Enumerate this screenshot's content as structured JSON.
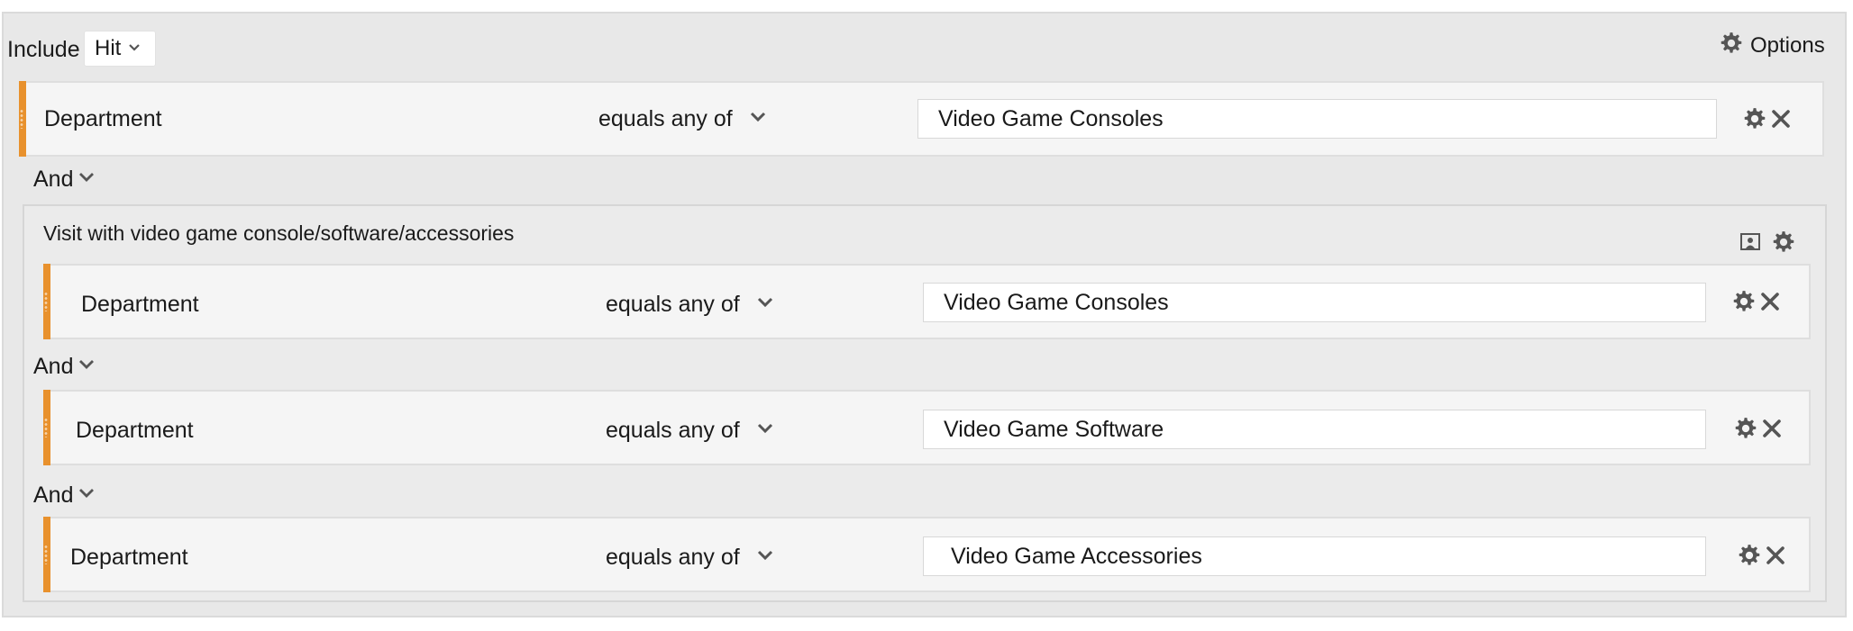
{
  "header": {
    "include_label": "Include",
    "include_value": "Hit",
    "options_label": "Options"
  },
  "top_rule": {
    "field": "Department",
    "operator": "equals any of",
    "value": "Video Game Consoles"
  },
  "top_conjunction": "And",
  "container": {
    "title": "Visit with video game console/software/accessories",
    "rules": [
      {
        "field": "Department",
        "operator": "equals any of",
        "value": "Video Game Consoles"
      },
      {
        "field": "Department",
        "operator": "equals any of",
        "value": "Video Game Software"
      },
      {
        "field": "Department",
        "operator": "equals any of",
        "value": "Video Game Accessories"
      }
    ],
    "conjunctions": [
      "And",
      "And"
    ]
  },
  "colors": {
    "accent_bar": "#e8912d",
    "panel_bg": "#e8e8e8",
    "rule_bg": "#f5f5f5",
    "icon": "#555555"
  },
  "icons": [
    "chevron-down-icon",
    "gear-icon",
    "close-icon",
    "container-icon"
  ]
}
